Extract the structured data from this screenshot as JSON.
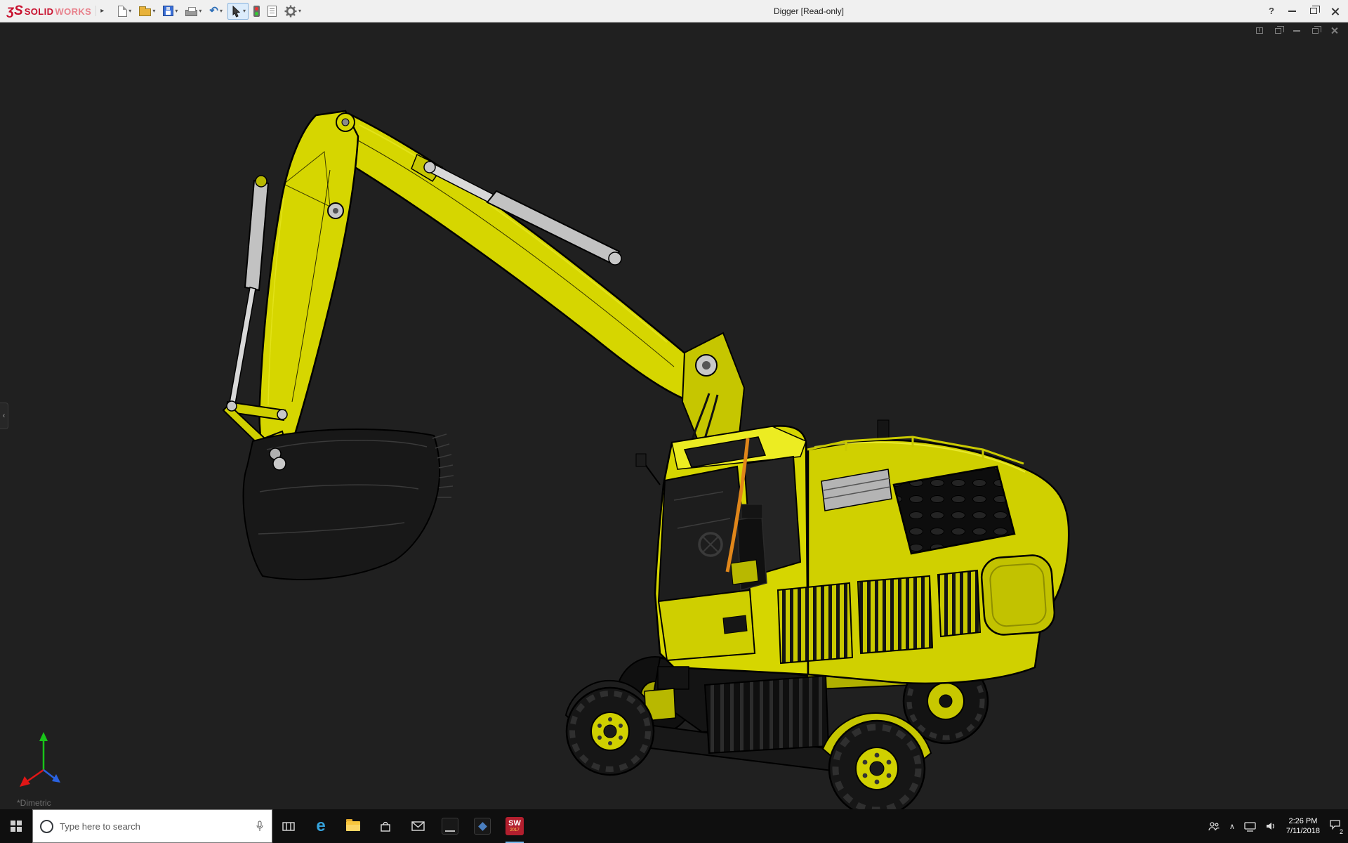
{
  "titlebar": {
    "brand": {
      "glyph": "ʒS",
      "solid": "SOLID",
      "works": "WORKS"
    },
    "title": "Digger [Read-only]",
    "help_label": "?",
    "toolbar": {
      "flyout_glyph": "▸",
      "dropdown_glyph": "▾",
      "buttons": [
        {
          "id": "new-document",
          "dropdown": true
        },
        {
          "id": "open",
          "dropdown": true
        },
        {
          "id": "save",
          "dropdown": true
        },
        {
          "id": "print",
          "dropdown": true
        },
        {
          "id": "undo",
          "dropdown": true
        },
        {
          "id": "select",
          "dropdown": true,
          "active": true
        },
        {
          "id": "rebuild",
          "dropdown": false
        },
        {
          "id": "file-properties",
          "dropdown": false
        },
        {
          "id": "options",
          "dropdown": true
        }
      ]
    }
  },
  "document_window": {
    "controls": [
      "new-window",
      "cascade",
      "minimize",
      "restore",
      "close"
    ]
  },
  "viewport": {
    "orientation_label": "*Dimetric",
    "background_color": "#202020",
    "model": "yellow wheeled excavator (digger), dimetric view"
  },
  "taskbar": {
    "search": {
      "placeholder": "Type here to search"
    },
    "apps": [
      "task-view",
      "edge",
      "file-explorer",
      "store",
      "mail",
      "command-prompt",
      "3d-viewer",
      "solidworks-2017"
    ],
    "edge_letter": "e",
    "solidworks_icon": {
      "label": "SW",
      "year": "2017"
    },
    "tray": {
      "hidden_icons_glyph": "∧",
      "time": "2:26 PM",
      "date": "7/11/2018",
      "notification_badge": "2"
    }
  },
  "colors": {
    "digger_yellow": "#d6d600",
    "solidworks_red": "#c8102e",
    "accent_blue": "#76b9ed",
    "titlebar_bg": "#f0f0f0",
    "taskbar_bg": "#0f0f0f",
    "viewport_bg": "#202020"
  }
}
